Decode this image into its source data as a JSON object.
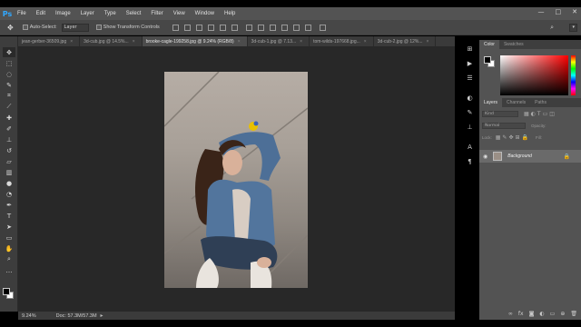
{
  "app": {
    "logo": "Ps"
  },
  "menu": [
    "File",
    "Edit",
    "Image",
    "Layer",
    "Type",
    "Select",
    "Filter",
    "View",
    "Window",
    "Help"
  ],
  "window_controls": [
    "—",
    "□",
    "✕"
  ],
  "options": {
    "auto_select_label": "Auto-Select:",
    "auto_select_value": "Layer",
    "transform_label": "Show Transform Controls"
  },
  "tabs": [
    {
      "label": "jean-gerber-36509.jpg",
      "active": false
    },
    {
      "label": "3d-cub.jpg @ 14.5%...",
      "active": false
    },
    {
      "label": "brooke-cagle-199258.jpg @ 9.24% (RGB/8)",
      "active": true
    },
    {
      "label": "3d-cub-1.jpg @ 7.13...",
      "active": false
    },
    {
      "label": "tom-wilds-197668.jpg...",
      "active": false
    },
    {
      "label": "3d-cub-2.jpg @ 12%...",
      "active": false
    }
  ],
  "status": {
    "zoom": "9.24%",
    "doc": "Doc: 57.3M/57.3M"
  },
  "color_panel": {
    "tabs": [
      "Color",
      "Swatches"
    ],
    "fg": "#000000",
    "bg": "#ffffff",
    "hue": "#ff0000"
  },
  "layers_panel": {
    "tabs": [
      "Layers",
      "Channels",
      "Paths"
    ],
    "kind_label": "Kind",
    "blend_mode": "Normal",
    "opacity_label": "Opacity:",
    "lock_label": "Lock:",
    "fill_label": "Fill:",
    "layer_name": "Background"
  }
}
